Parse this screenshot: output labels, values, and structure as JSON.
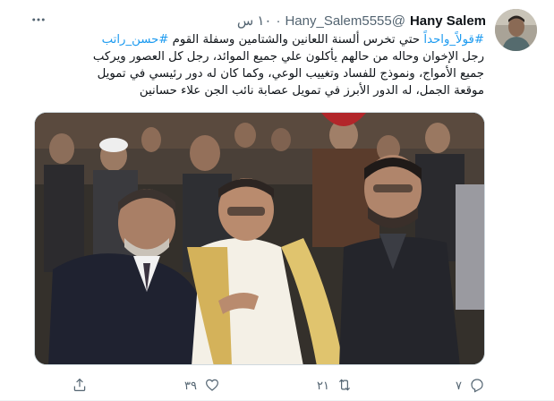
{
  "tweet": {
    "author_name": "Hany Salem",
    "handle": "@Hany_Salem5555",
    "separator": "·",
    "time": "١٠ س",
    "hashtag_1": "#قولاً_واحداً",
    "text_line1_rest": " حتي تخرس ألسنة اللعانين والشتامين وسفلة القوم ",
    "hashtag_2": "#حسن_راتب",
    "text_line2": "رجل الإخوان وحاله من حالهم يأكلون علي جميع الموائد، رجل كل العصور ويركب",
    "text_line3": "جميع الأمواج، ونموذج للفساد وتغييب الوعي، وكما كان له دور رئيسي في تمويل",
    "text_line4": "موقعة الجمل، له الدور الأبرز في تمويل عصابة نائب الجن علاء حسانين"
  },
  "actions": {
    "reply_count": "٧",
    "retweet_count": "٢١",
    "like_count": "٣٩",
    "share_count": ""
  },
  "icons": {
    "more": "more-icon",
    "reply": "reply-icon",
    "retweet": "retweet-icon",
    "like": "heart-icon",
    "share": "share-icon"
  },
  "colors": {
    "link": "#1d9bf0",
    "secondary_text": "#536471",
    "primary_text": "#0f1419"
  }
}
